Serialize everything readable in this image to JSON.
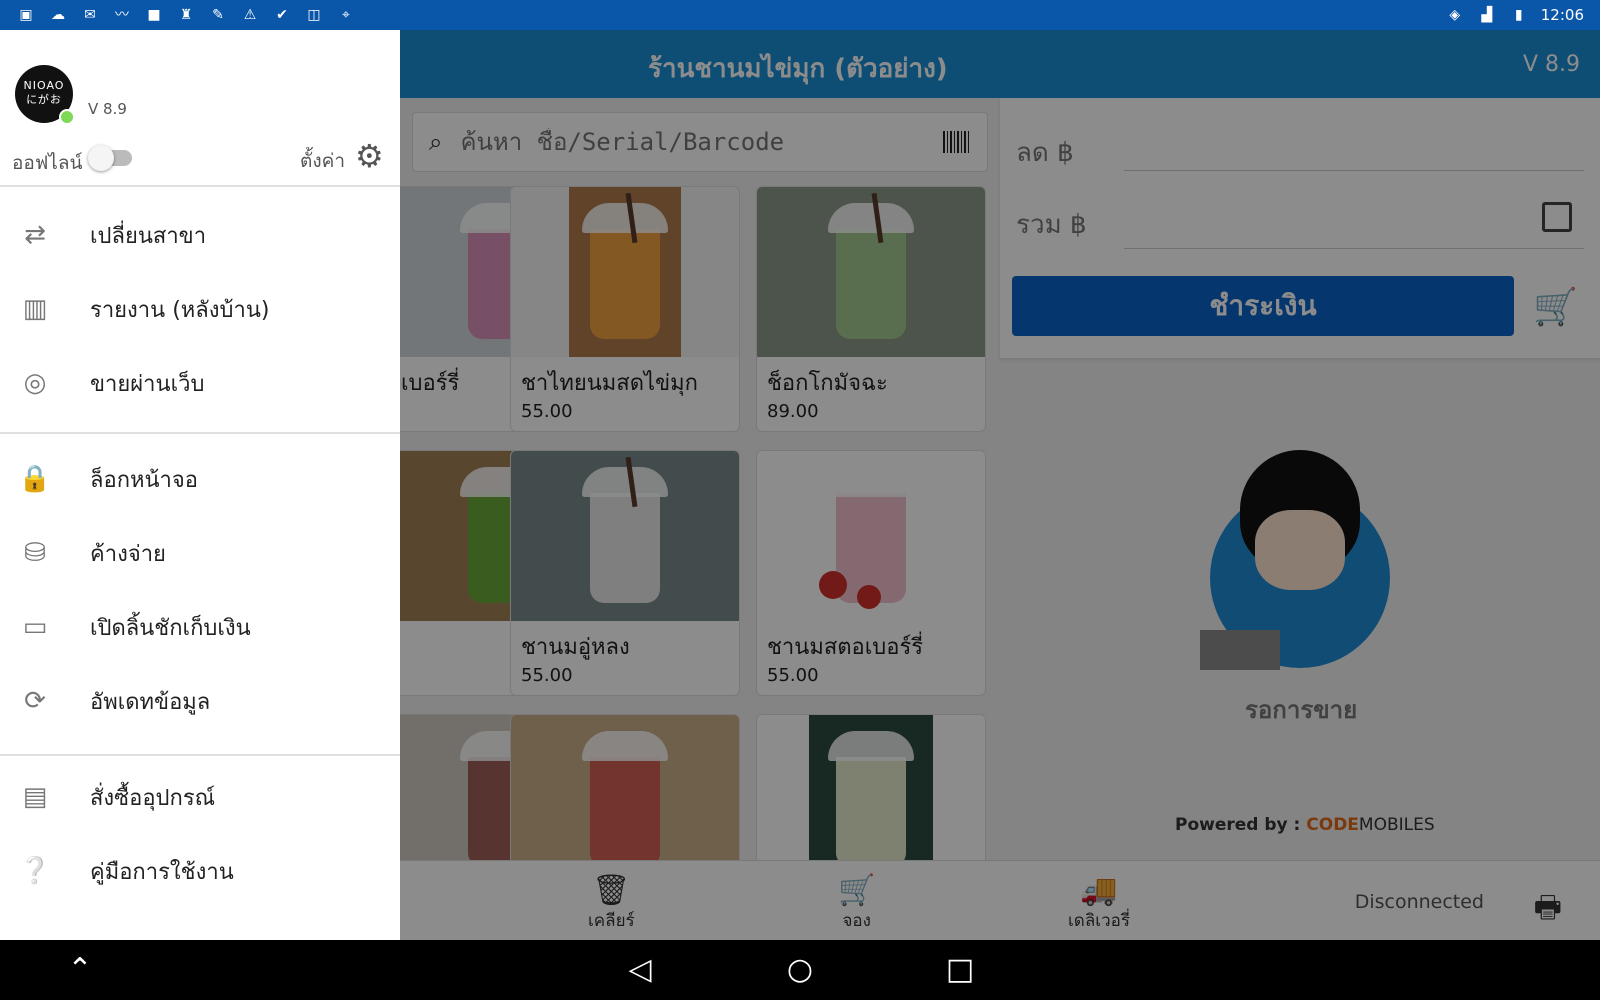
{
  "status_bar": {
    "time": "12:06",
    "icons": [
      "image-icon",
      "weather-icon",
      "mail-icon",
      "trend-icon",
      "square-icon",
      "person-icon",
      "wrench-icon",
      "warning-icon",
      "check-icon",
      "board-icon",
      "location-icon"
    ],
    "right_icons": [
      "wifi-icon",
      "signal-icon",
      "battery-icon"
    ]
  },
  "header": {
    "title": "ร้านชานมไข่มุก (ตัวอย่าง)",
    "version": "V 8.9"
  },
  "search": {
    "placeholder": "ค้นหา ชื่อ/Serial/Barcode"
  },
  "products": [
    {
      "name": "เบอร์รี่",
      "price": "",
      "top_color": "#d9a3c4",
      "cup_color": "#d992b8"
    },
    {
      "name": "ชาไทยนมสดไข่มุก",
      "price": "55.00",
      "top_color": "#b07a4a",
      "cup_color": "#f0a040"
    },
    {
      "name": "ช็อกโกมัจฉะ",
      "price": "89.00",
      "top_color": "#8a9a8a",
      "cup_color": "#a3c98e"
    },
    {
      "name": "",
      "price": "",
      "top_color": "#a08055",
      "cup_color": "#6aaa3a"
    },
    {
      "name": "ชานมอู่หลง",
      "price": "55.00",
      "top_color": "#7a8a8a",
      "cup_color": "#e8e8e8"
    },
    {
      "name": "ชานมสตอเบอร์รี่",
      "price": "55.00",
      "top_color": "#ffffff",
      "cup_color": "#f2c0cc"
    },
    {
      "name": "",
      "price": "",
      "top_color": "#d0c8c0",
      "cup_color": "#a0605a"
    },
    {
      "name": "",
      "price": "",
      "top_color": "#c8b088",
      "cup_color": "#d06050"
    },
    {
      "name": "",
      "price": "",
      "top_color": "#2d4a40",
      "cup_color": "#e8eccc"
    }
  ],
  "summary": {
    "discount_label": "ลด ฿",
    "total_label": "รวม ฿",
    "pay_label": "ชำระเงิน",
    "waiting_label": "รอการขาย",
    "powered_prefix": "Powered by : ",
    "brand_part1": "CODE",
    "brand_part2": "MOBILES"
  },
  "bottom_bar": {
    "clear_label": "เคลียร์",
    "reserve_label": "จอง",
    "delivery_label": "เดลิเวอรี่",
    "printer_status": "Disconnected"
  },
  "drawer": {
    "logo_line1": "NIOAO",
    "logo_line2": "にがお",
    "version": "V 8.9",
    "offline_label": "ออฟไลน์",
    "offline_enabled": false,
    "settings_label": "ตั้งค่า",
    "groups": [
      [
        {
          "label": "เปลี่ยนสาขา",
          "icon": "swap-icon",
          "glyph": "⇄"
        },
        {
          "label": "รายงาน (หลังบ้าน)",
          "icon": "report-chart-icon",
          "glyph": "📊"
        },
        {
          "label": "ขายผ่านเว็บ",
          "icon": "web-browser-icon",
          "glyph": "◎"
        }
      ],
      [
        {
          "label": "ล็อกหน้าจอ",
          "icon": "lock-icon",
          "glyph": "🔒"
        },
        {
          "label": "ค้างจ่าย",
          "icon": "coins-clock-icon",
          "glyph": "⛁"
        },
        {
          "label": "เปิดลิ้นชักเก็บเงิน",
          "icon": "cash-drawer-icon",
          "glyph": "▭"
        },
        {
          "label": "อัพเดทข้อมูล",
          "icon": "sync-icon",
          "glyph": "⟳"
        }
      ],
      [
        {
          "label": "สั่งซื้ออุปกรณ์",
          "icon": "cash-register-icon",
          "glyph": "🖶"
        },
        {
          "label": "คู่มือการใช้งาน",
          "icon": "help-book-icon",
          "glyph": "❔"
        }
      ]
    ]
  }
}
